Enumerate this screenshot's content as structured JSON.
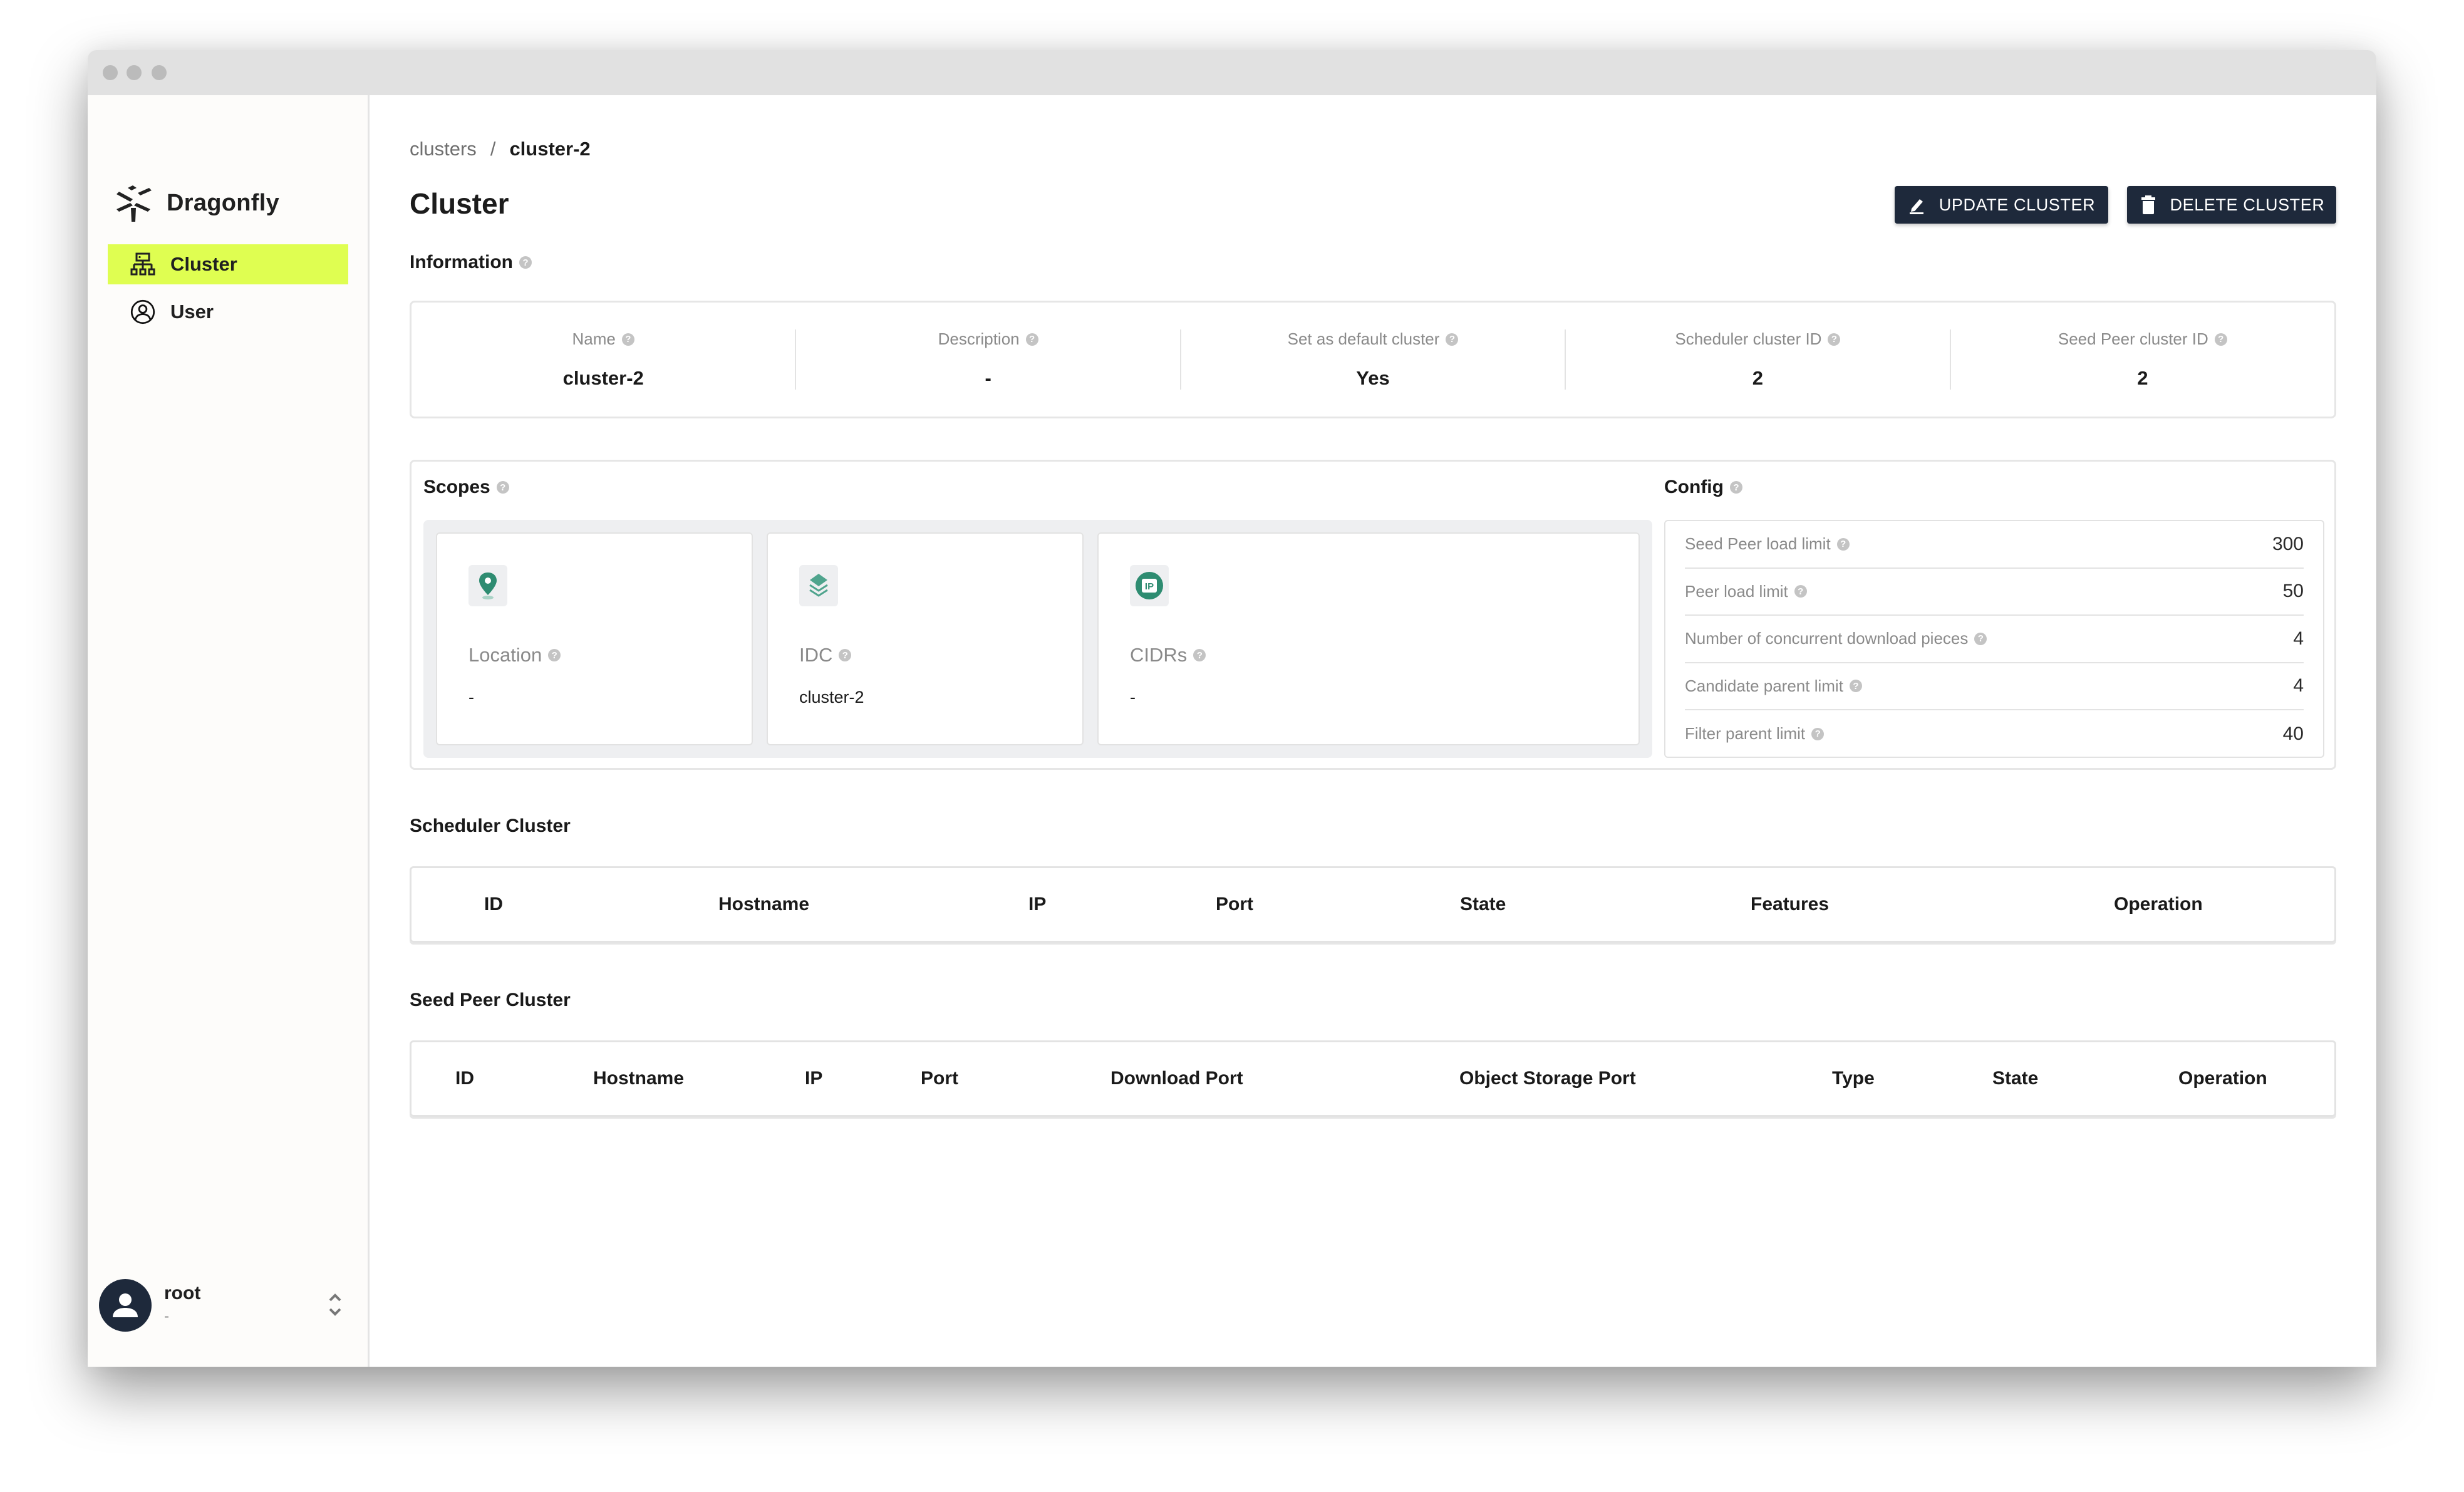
{
  "window": {
    "traffic_lights": [
      "close",
      "minimize",
      "maximize"
    ]
  },
  "sidebar": {
    "brand": "Dragonfly",
    "logo_icon": "dragonfly-logo-icon",
    "items": [
      {
        "label": "Cluster",
        "icon": "cluster-icon",
        "active": true
      },
      {
        "label": "User",
        "icon": "user-circle-icon",
        "active": false
      }
    ],
    "profile": {
      "name": "root",
      "subtitle": "-",
      "avatar_icon": "person-icon",
      "toggle_icon": "chevron-up-down-icon"
    }
  },
  "breadcrumb": {
    "parent": "clusters",
    "separator": "/",
    "current": "cluster-2"
  },
  "page": {
    "title": "Cluster"
  },
  "actions": {
    "update_label": "UPDATE CLUSTER",
    "update_icon": "pencil-icon",
    "delete_label": "DELETE CLUSTER",
    "delete_icon": "trash-icon"
  },
  "colors": {
    "accent": "#dffe51",
    "primary_button": "#1e293b",
    "scope_icon_green": "#2e8c71"
  },
  "information": {
    "title": "Information",
    "fields": [
      {
        "label": "Name",
        "value": "cluster-2"
      },
      {
        "label": "Description",
        "value": "-"
      },
      {
        "label": "Set as default cluster",
        "value": "Yes"
      },
      {
        "label": "Scheduler cluster ID",
        "value": "2"
      },
      {
        "label": "Seed Peer cluster ID",
        "value": "2"
      }
    ]
  },
  "scopes": {
    "title": "Scopes",
    "items": [
      {
        "label": "Location",
        "value": "-",
        "icon": "location-pin-icon"
      },
      {
        "label": "IDC",
        "value": "cluster-2",
        "icon": "layers-icon"
      },
      {
        "label": "CIDRs",
        "value": "-",
        "icon": "ip-icon"
      }
    ]
  },
  "config": {
    "title": "Config",
    "rows": [
      {
        "label": "Seed Peer load limit",
        "value": "300"
      },
      {
        "label": "Peer load limit",
        "value": "50"
      },
      {
        "label": "Number of concurrent download pieces",
        "value": "4"
      },
      {
        "label": "Candidate parent limit",
        "value": "4"
      },
      {
        "label": "Filter parent limit",
        "value": "40"
      }
    ]
  },
  "scheduler_cluster": {
    "title": "Scheduler Cluster",
    "columns": [
      "ID",
      "Hostname",
      "IP",
      "Port",
      "State",
      "Features",
      "Operation"
    ],
    "rows": []
  },
  "seed_peer_cluster": {
    "title": "Seed Peer Cluster",
    "columns": [
      "ID",
      "Hostname",
      "IP",
      "Port",
      "Download Port",
      "Object Storage Port",
      "Type",
      "State",
      "Operation"
    ],
    "rows": []
  },
  "help_glyph": "?"
}
